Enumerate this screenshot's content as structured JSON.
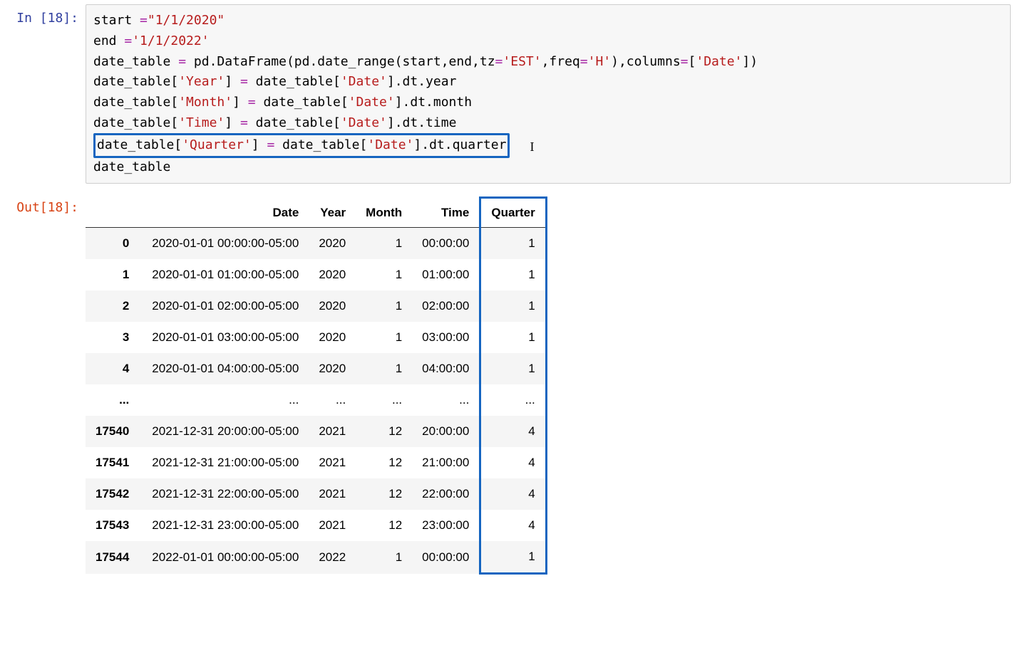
{
  "prompts": {
    "in": "In [18]:",
    "out": "Out[18]:"
  },
  "code": {
    "tokens": [
      [
        "start ",
        "var"
      ],
      [
        "=",
        "op"
      ],
      [
        "\"1/1/2020\"",
        "str"
      ],
      [
        "\n",
        "br"
      ],
      [
        "end ",
        "var"
      ],
      [
        "=",
        "op"
      ],
      [
        "'1/1/2022'",
        "str"
      ],
      [
        "\n",
        "br"
      ],
      [
        "date_table ",
        "var"
      ],
      [
        "= ",
        "op"
      ],
      [
        "pd.DataFrame(pd.date_range(start,end,tz",
        "var"
      ],
      [
        "=",
        "op"
      ],
      [
        "'EST'",
        "str"
      ],
      [
        ",freq",
        "var"
      ],
      [
        "=",
        "op"
      ],
      [
        "'H'",
        "str"
      ],
      [
        "),columns",
        "var"
      ],
      [
        "=",
        "op"
      ],
      [
        "[",
        "var"
      ],
      [
        "'Date'",
        "str"
      ],
      [
        "])",
        "var"
      ],
      [
        "\n",
        "br"
      ],
      [
        "date_table[",
        "var"
      ],
      [
        "'Year'",
        "str"
      ],
      [
        "] ",
        "var"
      ],
      [
        "= ",
        "op"
      ],
      [
        "date_table[",
        "var"
      ],
      [
        "'Date'",
        "str"
      ],
      [
        "].dt.year",
        "var"
      ],
      [
        "\n",
        "br"
      ],
      [
        "date_table[",
        "var"
      ],
      [
        "'Month'",
        "str"
      ],
      [
        "] ",
        "var"
      ],
      [
        "= ",
        "op"
      ],
      [
        "date_table[",
        "var"
      ],
      [
        "'Date'",
        "str"
      ],
      [
        "].dt.month",
        "var"
      ],
      [
        "\n",
        "br"
      ],
      [
        "date_table[",
        "var"
      ],
      [
        "'Time'",
        "str"
      ],
      [
        "] ",
        "var"
      ],
      [
        "= ",
        "op"
      ],
      [
        "date_table[",
        "var"
      ],
      [
        "'Date'",
        "str"
      ],
      [
        "].dt.time",
        "var"
      ],
      [
        "\n",
        "br"
      ],
      [
        "HLSTART",
        "marker"
      ],
      [
        "date_table[",
        "var"
      ],
      [
        "'Quarter'",
        "str"
      ],
      [
        "] ",
        "var"
      ],
      [
        "= ",
        "op"
      ],
      [
        "date_table[",
        "var"
      ],
      [
        "'Date'",
        "str"
      ],
      [
        "].dt.quarter",
        "var"
      ],
      [
        "HLEND",
        "marker"
      ],
      [
        "CURSOR",
        "marker"
      ],
      [
        "\n",
        "br"
      ],
      [
        "date_table",
        "var"
      ]
    ]
  },
  "dataframe": {
    "columns": [
      "",
      "Date",
      "Year",
      "Month",
      "Time",
      "Quarter"
    ],
    "highlight_col": 5,
    "rows": [
      {
        "idx": "0",
        "Date": "2020-01-01 00:00:00-05:00",
        "Year": "2020",
        "Month": "1",
        "Time": "00:00:00",
        "Quarter": "1"
      },
      {
        "idx": "1",
        "Date": "2020-01-01 01:00:00-05:00",
        "Year": "2020",
        "Month": "1",
        "Time": "01:00:00",
        "Quarter": "1"
      },
      {
        "idx": "2",
        "Date": "2020-01-01 02:00:00-05:00",
        "Year": "2020",
        "Month": "1",
        "Time": "02:00:00",
        "Quarter": "1"
      },
      {
        "idx": "3",
        "Date": "2020-01-01 03:00:00-05:00",
        "Year": "2020",
        "Month": "1",
        "Time": "03:00:00",
        "Quarter": "1"
      },
      {
        "idx": "4",
        "Date": "2020-01-01 04:00:00-05:00",
        "Year": "2020",
        "Month": "1",
        "Time": "04:00:00",
        "Quarter": "1"
      },
      {
        "idx": "...",
        "Date": "...",
        "Year": "...",
        "Month": "...",
        "Time": "...",
        "Quarter": "..."
      },
      {
        "idx": "17540",
        "Date": "2021-12-31 20:00:00-05:00",
        "Year": "2021",
        "Month": "12",
        "Time": "20:00:00",
        "Quarter": "4"
      },
      {
        "idx": "17541",
        "Date": "2021-12-31 21:00:00-05:00",
        "Year": "2021",
        "Month": "12",
        "Time": "21:00:00",
        "Quarter": "4"
      },
      {
        "idx": "17542",
        "Date": "2021-12-31 22:00:00-05:00",
        "Year": "2021",
        "Month": "12",
        "Time": "22:00:00",
        "Quarter": "4"
      },
      {
        "idx": "17543",
        "Date": "2021-12-31 23:00:00-05:00",
        "Year": "2021",
        "Month": "12",
        "Time": "23:00:00",
        "Quarter": "4"
      },
      {
        "idx": "17544",
        "Date": "2022-01-01 00:00:00-05:00",
        "Year": "2022",
        "Month": "1",
        "Time": "00:00:00",
        "Quarter": "1"
      }
    ]
  }
}
